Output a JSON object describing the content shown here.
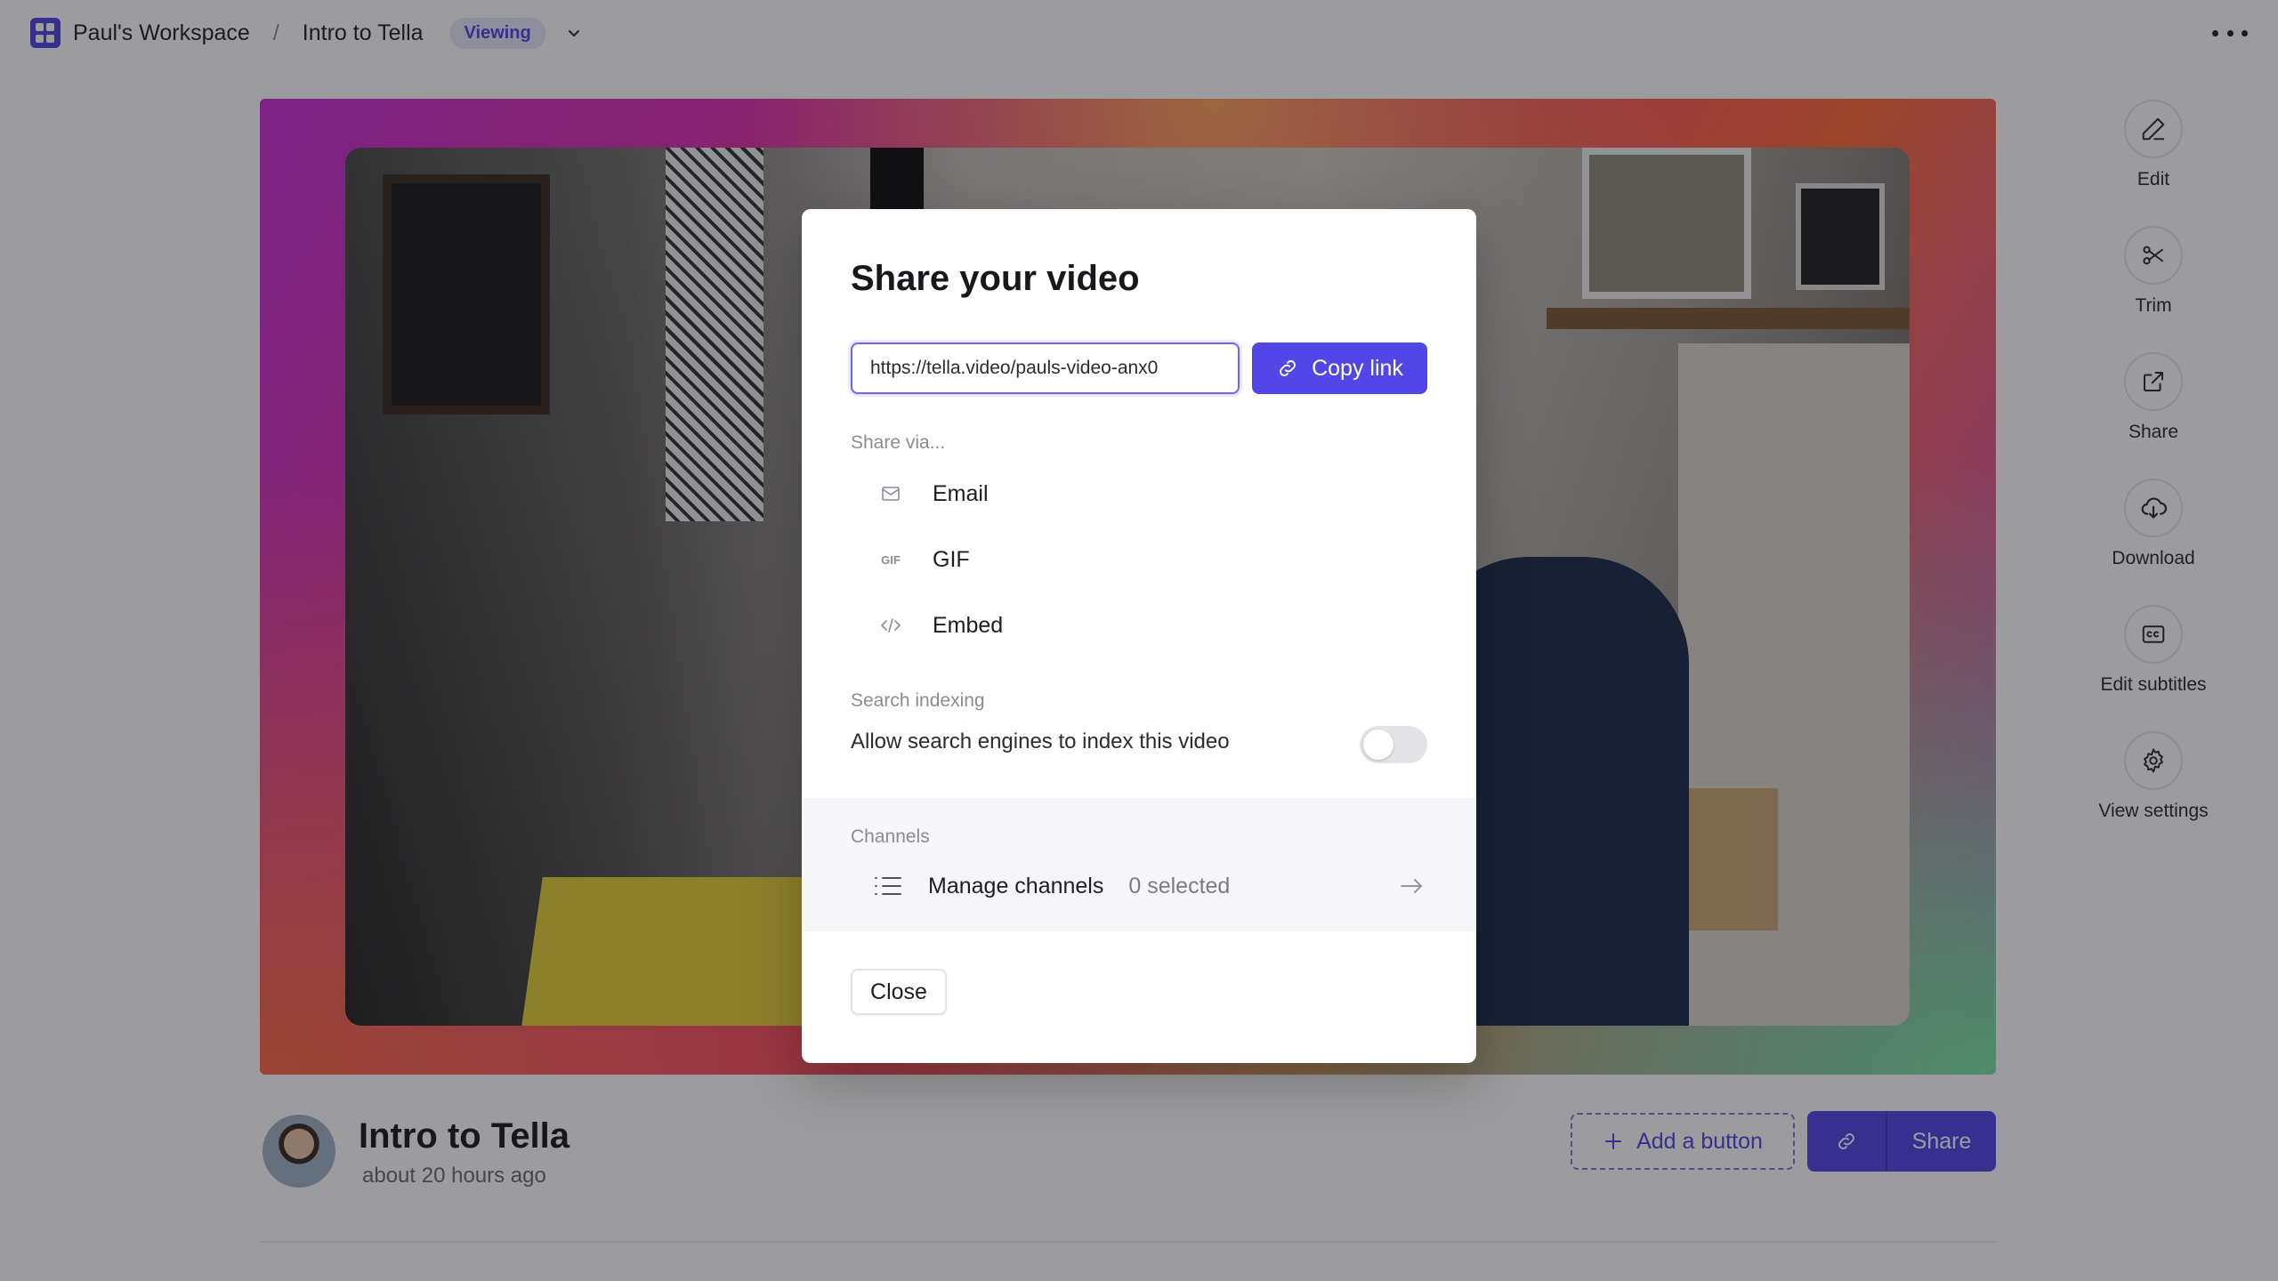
{
  "topbar": {
    "workspace": "Paul's Workspace",
    "separator": "/",
    "video_title": "Intro to Tella",
    "mode_badge": "Viewing"
  },
  "video": {
    "title": "Intro to Tella",
    "time_ago": "about 20 hours ago"
  },
  "actions": {
    "add_button": "Add a button",
    "share": "Share"
  },
  "rail": [
    {
      "label": "Edit",
      "icon": "pencil-icon"
    },
    {
      "label": "Trim",
      "icon": "scissors-icon"
    },
    {
      "label": "Share",
      "icon": "external-link-icon"
    },
    {
      "label": "Download",
      "icon": "cloud-download-icon"
    },
    {
      "label": "Edit subtitles",
      "icon": "cc-icon"
    },
    {
      "label": "View settings",
      "icon": "gear-icon"
    }
  ],
  "modal": {
    "title": "Share your video",
    "url": "https://tella.video/pauls-video-anx0",
    "copy_link": "Copy link",
    "share_via_label": "Share via...",
    "share_options": [
      {
        "label": "Email",
        "icon": "mail-icon"
      },
      {
        "label": "GIF",
        "icon": "gif-icon",
        "icon_text": "GIF"
      },
      {
        "label": "Embed",
        "icon": "code-icon"
      }
    ],
    "search_indexing_label": "Search indexing",
    "search_indexing_text": "Allow search engines to index this video",
    "search_indexing_enabled": false,
    "channels_label": "Channels",
    "manage_channels": "Manage channels",
    "channels_selected": "0 selected",
    "close": "Close"
  },
  "colors": {
    "accent": "#5146e6",
    "badge_bg": "#e7e6fb"
  }
}
